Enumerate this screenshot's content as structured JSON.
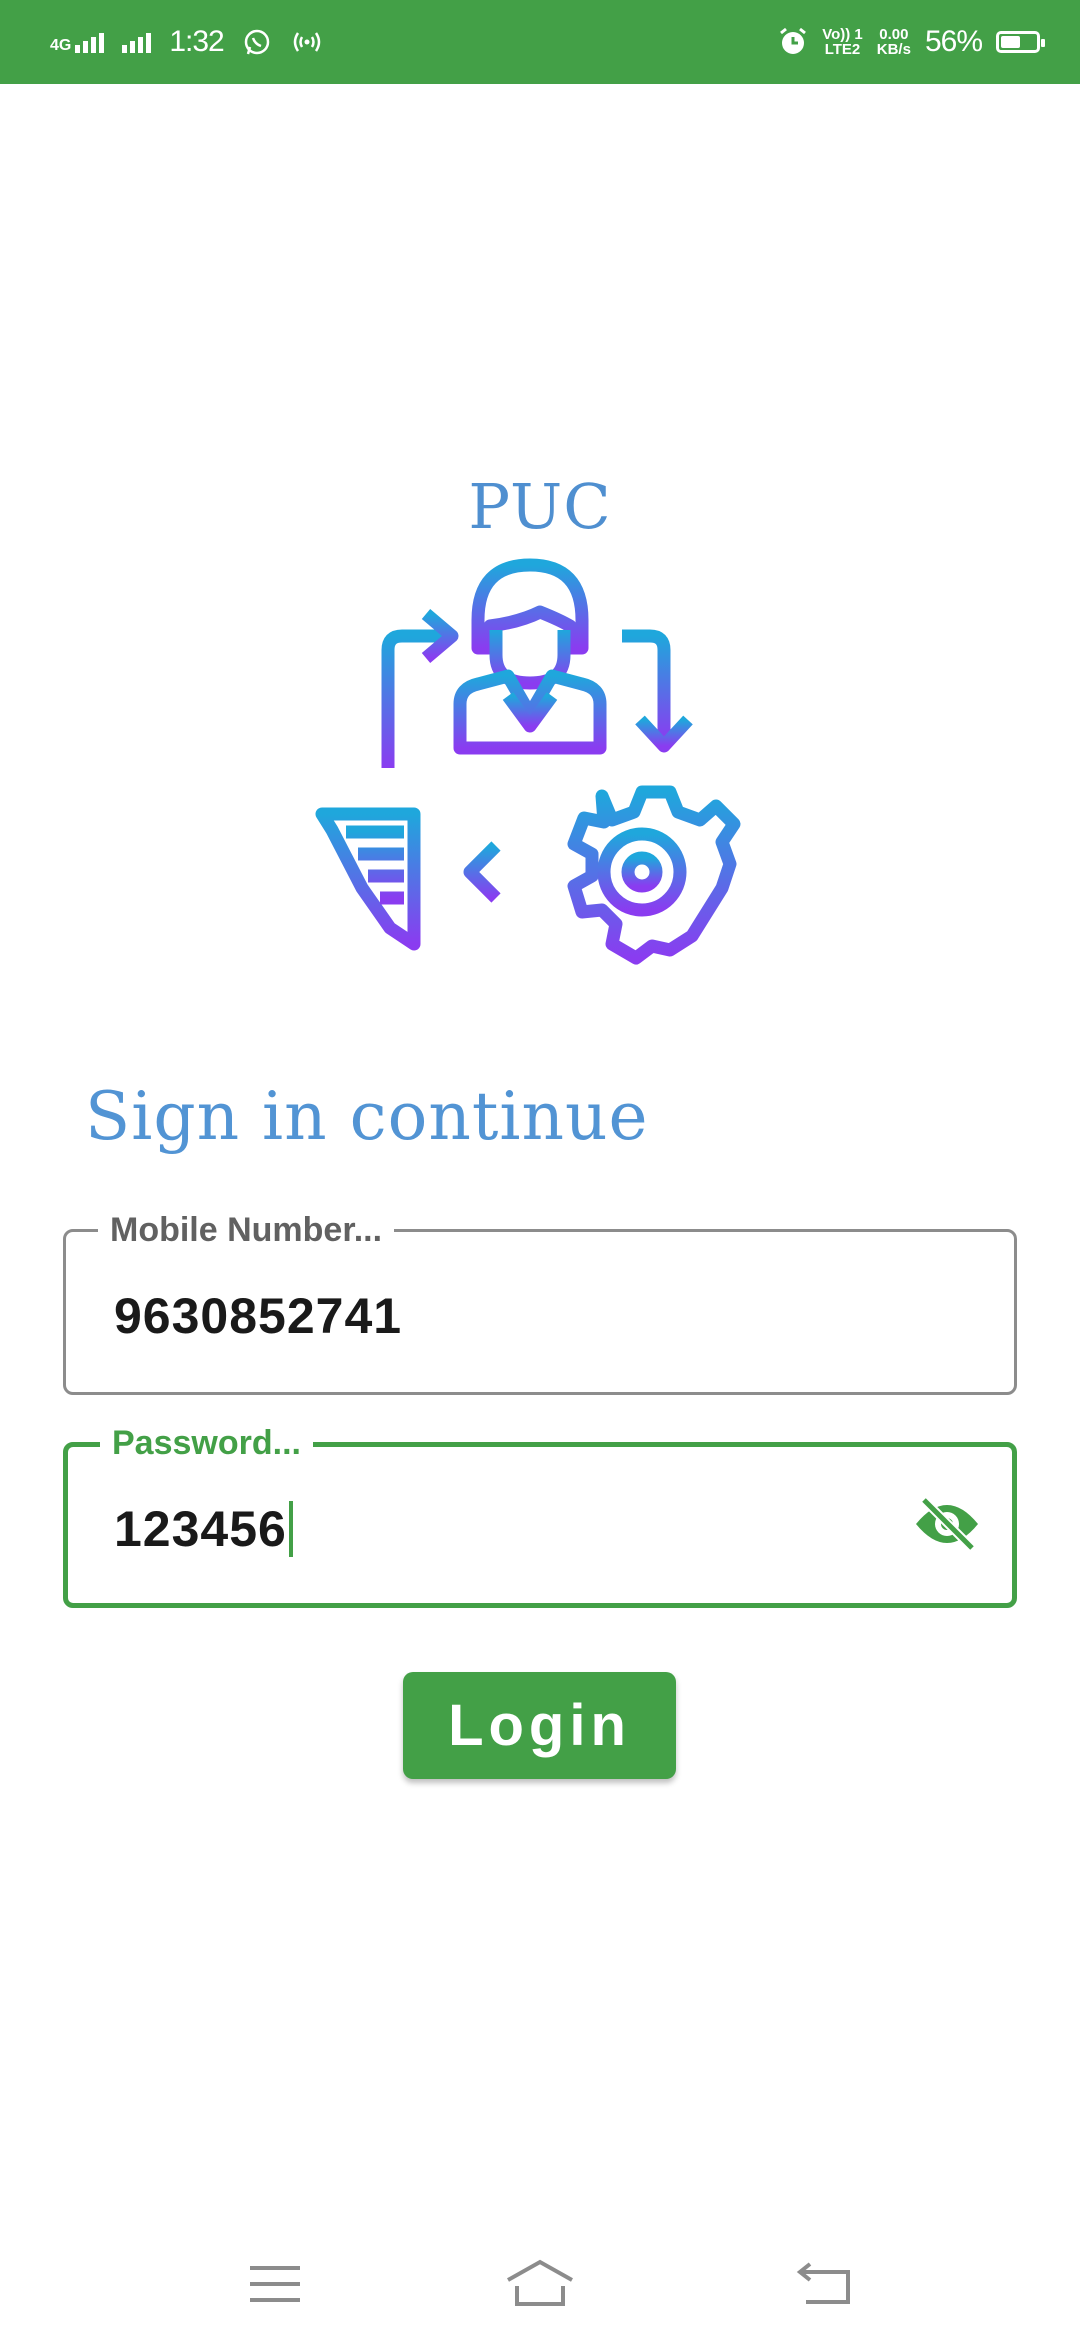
{
  "status_bar": {
    "network": "4G",
    "time": "1:32",
    "volte": "Vo)) 1",
    "lte": "LTE2",
    "speed_value": "0.00",
    "speed_unit": "KB/s",
    "battery": "56%",
    "battery_level": 0.56,
    "icons": [
      "signal-icon",
      "whatsapp-icon",
      "hotspot-icon",
      "alarm-icon",
      "battery-icon"
    ]
  },
  "logo": {
    "title": "PUC",
    "icon": "puc-process-logo",
    "colors": {
      "top": "#1fa7dc",
      "bottom": "#8a3cf0"
    }
  },
  "heading": "Sign in continue",
  "form": {
    "mobile": {
      "label": "Mobile Number...",
      "value": "9630852741"
    },
    "password": {
      "label": "Password...",
      "value": "123456",
      "toggle_icon": "eye-off-icon"
    }
  },
  "login_button": {
    "label": "Login"
  },
  "nav_bar": {
    "icons": [
      "menu-icon",
      "home-icon",
      "back-icon"
    ]
  },
  "colors": {
    "accent": "#43a047",
    "heading": "#5294d4",
    "border": "#8c8c8c"
  }
}
